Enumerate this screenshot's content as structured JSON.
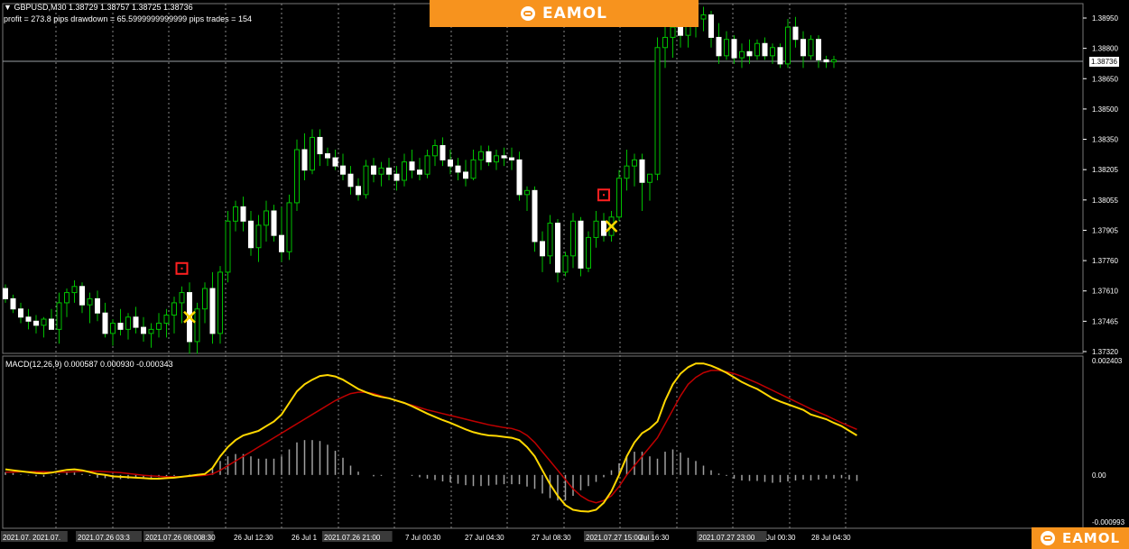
{
  "symbol_header": {
    "triangle": "▼",
    "quote": "GBPUSD,M30  1.38729 1.38757 1.38725 1.38736",
    "stats": "profit = 273.8 pips     drawdown = 65.5999999999999 pips     trades = 154"
  },
  "brand": {
    "name": "EAMOL",
    "icon": "robot-logo-icon",
    "color": "#f7931e"
  },
  "price_axis": {
    "labels": [
      "1.38950",
      "1.38800",
      "1.38650",
      "1.38500",
      "1.38350",
      "1.38205",
      "1.38055",
      "1.37905",
      "1.37760",
      "1.37610",
      "1.37465",
      "1.37320"
    ],
    "current_price": "1.38736"
  },
  "macd_panel": {
    "label": "MACD(12,26,9) 0.000587 0.000930 -0.000343",
    "axis_labels": [
      "0.002403",
      "0.00",
      "-0.000993"
    ]
  },
  "time_axis": {
    "labels": [
      "2021.07.",
      "2021.07.",
      "2021.07.26 03:3",
      "2021.07.26 08:00",
      "8:30",
      "26 Jul 12:30",
      "26 Jul 1",
      "2021.07.26 21:00",
      "7 Jul 00:30",
      "27 Jul 04:30",
      "27 Jul 08:30",
      "2021.07.27 15:00",
      "Jul 16:30",
      "2021.07.27 23:00",
      "Jul 00:30",
      "28 Jul 04:30"
    ]
  },
  "colors": {
    "background": "#000000",
    "bull_candle": "#00c000",
    "bear_candle": "#ffffff",
    "wick": "#00c000",
    "macd_line": "#ffd700",
    "signal_line": "#c00000",
    "histogram": "#a0a0a0",
    "grid": "#777777",
    "marker_square": "#ff2020",
    "marker_cross": "#ffd700"
  },
  "chart_data": {
    "type": "candlestick",
    "title": "GBPUSD,M30",
    "y_range": [
      1.3732,
      1.3898
    ],
    "last_close": 1.38736,
    "ohlc": [
      [
        1.3762,
        1.3764,
        1.3755,
        1.3757
      ],
      [
        1.3757,
        1.3759,
        1.375,
        1.3752
      ],
      [
        1.3752,
        1.3755,
        1.3745,
        1.3748
      ],
      [
        1.3748,
        1.3752,
        1.3742,
        1.3746
      ],
      [
        1.3746,
        1.3749,
        1.374,
        1.3744
      ],
      [
        1.3744,
        1.3748,
        1.3738,
        1.3747
      ],
      [
        1.3747,
        1.3752,
        1.3743,
        1.3742
      ],
      [
        1.3742,
        1.376,
        1.3735,
        1.3755
      ],
      [
        1.3755,
        1.3762,
        1.3748,
        1.376
      ],
      [
        1.376,
        1.3766,
        1.3755,
        1.3763
      ],
      [
        1.3763,
        1.3765,
        1.375,
        1.3754
      ],
      [
        1.3754,
        1.376,
        1.3745,
        1.3757
      ],
      [
        1.3757,
        1.3761,
        1.3746,
        1.375
      ],
      [
        1.375,
        1.3755,
        1.3738,
        1.374
      ],
      [
        1.374,
        1.3747,
        1.3734,
        1.3745
      ],
      [
        1.3745,
        1.3752,
        1.3739,
        1.3742
      ],
      [
        1.3742,
        1.375,
        1.3737,
        1.3748
      ],
      [
        1.3748,
        1.3753,
        1.374,
        1.3743
      ],
      [
        1.3743,
        1.3748,
        1.3736,
        1.374
      ],
      [
        1.374,
        1.3745,
        1.3733,
        1.3742
      ],
      [
        1.3742,
        1.375,
        1.3738,
        1.3745
      ],
      [
        1.3745,
        1.3752,
        1.3738,
        1.3749
      ],
      [
        1.3749,
        1.3758,
        1.374,
        1.3755
      ],
      [
        1.3755,
        1.3763,
        1.3745,
        1.376
      ],
      [
        1.376,
        1.3765,
        1.373,
        1.3736
      ],
      [
        1.3736,
        1.3755,
        1.373,
        1.3752
      ],
      [
        1.3752,
        1.3765,
        1.3745,
        1.3762
      ],
      [
        1.3762,
        1.377,
        1.3735,
        1.374
      ],
      [
        1.374,
        1.3773,
        1.3735,
        1.377
      ],
      [
        1.377,
        1.38,
        1.3765,
        1.3795
      ],
      [
        1.3795,
        1.3805,
        1.379,
        1.3802
      ],
      [
        1.3802,
        1.3807,
        1.379,
        1.3795
      ],
      [
        1.3795,
        1.38,
        1.3778,
        1.3782
      ],
      [
        1.3782,
        1.3798,
        1.3775,
        1.3793
      ],
      [
        1.3793,
        1.3805,
        1.3785,
        1.38
      ],
      [
        1.38,
        1.3803,
        1.3785,
        1.3788
      ],
      [
        1.3788,
        1.3802,
        1.3775,
        1.378
      ],
      [
        1.378,
        1.3808,
        1.3776,
        1.3804
      ],
      [
        1.3804,
        1.3835,
        1.38,
        1.383
      ],
      [
        1.383,
        1.3838,
        1.3815,
        1.382
      ],
      [
        1.382,
        1.384,
        1.3818,
        1.3836
      ],
      [
        1.3836,
        1.384,
        1.3822,
        1.3828
      ],
      [
        1.3828,
        1.3831,
        1.3822,
        1.3826
      ],
      [
        1.3826,
        1.383,
        1.382,
        1.3822
      ],
      [
        1.3822,
        1.3828,
        1.3815,
        1.3818
      ],
      [
        1.3818,
        1.3822,
        1.3808,
        1.3812
      ],
      [
        1.3812,
        1.3816,
        1.3805,
        1.3808
      ],
      [
        1.3808,
        1.3825,
        1.3806,
        1.3822
      ],
      [
        1.3822,
        1.3826,
        1.3814,
        1.3818
      ],
      [
        1.3818,
        1.3824,
        1.3812,
        1.3821
      ],
      [
        1.3821,
        1.3826,
        1.3815,
        1.3818
      ],
      [
        1.3818,
        1.3822,
        1.381,
        1.3815
      ],
      [
        1.3815,
        1.3828,
        1.3812,
        1.3824
      ],
      [
        1.3824,
        1.383,
        1.3816,
        1.382
      ],
      [
        1.382,
        1.3826,
        1.3815,
        1.3818
      ],
      [
        1.3818,
        1.383,
        1.3816,
        1.3827
      ],
      [
        1.3827,
        1.3835,
        1.3822,
        1.3832
      ],
      [
        1.3832,
        1.3836,
        1.3822,
        1.3825
      ],
      [
        1.3825,
        1.383,
        1.3818,
        1.3822
      ],
      [
        1.3822,
        1.3826,
        1.3815,
        1.3819
      ],
      [
        1.3819,
        1.3825,
        1.3812,
        1.3816
      ],
      [
        1.3816,
        1.383,
        1.3815,
        1.3825
      ],
      [
        1.3825,
        1.3832,
        1.382,
        1.3829
      ],
      [
        1.3829,
        1.3832,
        1.3822,
        1.3824
      ],
      [
        1.3824,
        1.383,
        1.382,
        1.3827
      ],
      [
        1.3827,
        1.3831,
        1.3822,
        1.3826
      ],
      [
        1.3826,
        1.3831,
        1.382,
        1.3825
      ],
      [
        1.3825,
        1.3829,
        1.3805,
        1.3808
      ],
      [
        1.3808,
        1.3812,
        1.38,
        1.381
      ],
      [
        1.381,
        1.3812,
        1.378,
        1.3785
      ],
      [
        1.3785,
        1.379,
        1.377,
        1.3778
      ],
      [
        1.3778,
        1.3798,
        1.3774,
        1.3794
      ],
      [
        1.3794,
        1.3796,
        1.3765,
        1.377
      ],
      [
        1.377,
        1.378,
        1.3768,
        1.3778
      ],
      [
        1.3778,
        1.3799,
        1.3772,
        1.3795
      ],
      [
        1.3795,
        1.3797,
        1.3768,
        1.3772
      ],
      [
        1.3772,
        1.379,
        1.377,
        1.3787
      ],
      [
        1.3787,
        1.38,
        1.3782,
        1.3795
      ],
      [
        1.3795,
        1.3799,
        1.3785,
        1.3788
      ],
      [
        1.3788,
        1.38,
        1.3785,
        1.3797
      ],
      [
        1.3797,
        1.382,
        1.3795,
        1.3816
      ],
      [
        1.3816,
        1.383,
        1.381,
        1.3822
      ],
      [
        1.3822,
        1.3828,
        1.3812,
        1.3825
      ],
      [
        1.3825,
        1.3828,
        1.38,
        1.3814
      ],
      [
        1.3814,
        1.3818,
        1.3805,
        1.3818
      ],
      [
        1.3818,
        1.3885,
        1.3815,
        1.388
      ],
      [
        1.388,
        1.3895,
        1.387,
        1.3885
      ],
      [
        1.3885,
        1.3898,
        1.3875,
        1.389
      ],
      [
        1.389,
        1.3895,
        1.388,
        1.3886
      ],
      [
        1.3886,
        1.3895,
        1.388,
        1.3892
      ],
      [
        1.3892,
        1.3898,
        1.3885,
        1.3894
      ],
      [
        1.3894,
        1.39,
        1.3888,
        1.3896
      ],
      [
        1.3896,
        1.3898,
        1.388,
        1.3885
      ],
      [
        1.3885,
        1.3892,
        1.3872,
        1.3876
      ],
      [
        1.3876,
        1.3888,
        1.3874,
        1.3884
      ],
      [
        1.3884,
        1.3886,
        1.3872,
        1.3875
      ],
      [
        1.3875,
        1.3882,
        1.387,
        1.3878
      ],
      [
        1.3878,
        1.3884,
        1.3872,
        1.3876
      ],
      [
        1.3876,
        1.3884,
        1.3874,
        1.3882
      ],
      [
        1.3882,
        1.3885,
        1.3874,
        1.3876
      ],
      [
        1.3876,
        1.3882,
        1.3872,
        1.388
      ],
      [
        1.388,
        1.3882,
        1.387,
        1.3872
      ],
      [
        1.3872,
        1.3894,
        1.387,
        1.389
      ],
      [
        1.389,
        1.3895,
        1.388,
        1.3884
      ],
      [
        1.3884,
        1.3888,
        1.387,
        1.3876
      ],
      [
        1.3876,
        1.3886,
        1.3874,
        1.3884
      ],
      [
        1.3884,
        1.3886,
        1.387,
        1.3874
      ],
      [
        1.3874,
        1.3876,
        1.387,
        1.3873
      ],
      [
        1.3873,
        1.3876,
        1.387,
        1.3874
      ]
    ],
    "markers": [
      {
        "type": "buy-square",
        "bar": 23
      },
      {
        "type": "close-cross",
        "bar": 24
      },
      {
        "type": "sell-square",
        "bar": 78
      },
      {
        "type": "close-cross",
        "bar": 79
      }
    ],
    "macd": {
      "main": [
        0.00012,
        0.0001,
        8e-05,
        6e-05,
        4e-05,
        3e-05,
        5e-05,
        8e-05,
        0.00011,
        0.00012,
        0.0001,
        6e-05,
        2e-05,
        0.0,
        -3e-05,
        -4e-05,
        -5e-05,
        -6e-05,
        -7e-05,
        -8e-05,
        -8e-05,
        -7e-05,
        -6e-05,
        -4e-05,
        -2e-05,
        0.0,
        2e-05,
        0.00015,
        0.0004,
        0.0006,
        0.00075,
        0.00085,
        0.0009,
        0.00095,
        0.00105,
        0.00115,
        0.0013,
        0.00155,
        0.0018,
        0.00195,
        0.00205,
        0.00213,
        0.00215,
        0.00212,
        0.00205,
        0.00195,
        0.00185,
        0.00178,
        0.00172,
        0.00168,
        0.00165,
        0.0016,
        0.00155,
        0.00148,
        0.0014,
        0.00132,
        0.00125,
        0.00118,
        0.00112,
        0.00105,
        0.00098,
        0.00092,
        0.00088,
        0.00085,
        0.00084,
        0.00082,
        0.0008,
        0.00075,
        0.0006,
        0.0004,
        0.0001,
        -0.0002,
        -0.00045,
        -0.00065,
        -0.00075,
        -0.00078,
        -0.00079,
        -0.00075,
        -0.0006,
        -0.00035,
        0.0,
        0.0004,
        0.0007,
        0.0009,
        0.001,
        0.00115,
        0.0016,
        0.00195,
        0.00218,
        0.00232,
        0.0024,
        0.0024,
        0.00235,
        0.00228,
        0.0022,
        0.0021,
        0.002,
        0.00192,
        0.00185,
        0.00175,
        0.00165,
        0.00158,
        0.00152,
        0.00146,
        0.0014,
        0.0013,
        0.00125,
        0.0012,
        0.00112,
        0.00105,
        0.00095,
        0.00085
      ],
      "signal": [
        6e-05,
        6e-05,
        7e-05,
        7e-05,
        7e-05,
        7e-05,
        6e-05,
        6e-05,
        6e-05,
        7e-05,
        8e-05,
        8e-05,
        8e-05,
        7e-05,
        6e-05,
        5e-05,
        3e-05,
        1e-05,
        -1e-05,
        -2e-05,
        -3e-05,
        -4e-05,
        -4e-05,
        -4e-05,
        -3e-05,
        -2e-05,
        -1e-05,
        2e-05,
        0.0001,
        0.0002,
        0.0003,
        0.0004,
        0.0005,
        0.0006,
        0.0007,
        0.0008,
        0.0009,
        0.001,
        0.0011,
        0.0012,
        0.0013,
        0.0014,
        0.0015,
        0.0016,
        0.00168,
        0.00175,
        0.00178,
        0.00178,
        0.00175,
        0.0017,
        0.00165,
        0.0016,
        0.00155,
        0.0015,
        0.00145,
        0.0014,
        0.00136,
        0.00132,
        0.00128,
        0.00124,
        0.0012,
        0.00116,
        0.00112,
        0.00108,
        0.00105,
        0.00102,
        0.001,
        0.00095,
        0.00085,
        0.0007,
        0.0005,
        0.0003,
        0.0001,
        -0.0001,
        -0.0003,
        -0.00045,
        -0.00055,
        -0.0006,
        -0.00055,
        -0.00045,
        -0.00025,
        0.0,
        0.0002,
        0.0004,
        0.0006,
        0.0008,
        0.0011,
        0.0014,
        0.0017,
        0.00195,
        0.0021,
        0.0022,
        0.00225,
        0.00225,
        0.00222,
        0.00218,
        0.00212,
        0.00205,
        0.00198,
        0.0019,
        0.00182,
        0.00174,
        0.00166,
        0.00158,
        0.0015,
        0.00142,
        0.00135,
        0.00128,
        0.0012,
        0.00112,
        0.00105,
        0.00098
      ],
      "range": [
        -0.000993,
        0.002403
      ]
    }
  }
}
